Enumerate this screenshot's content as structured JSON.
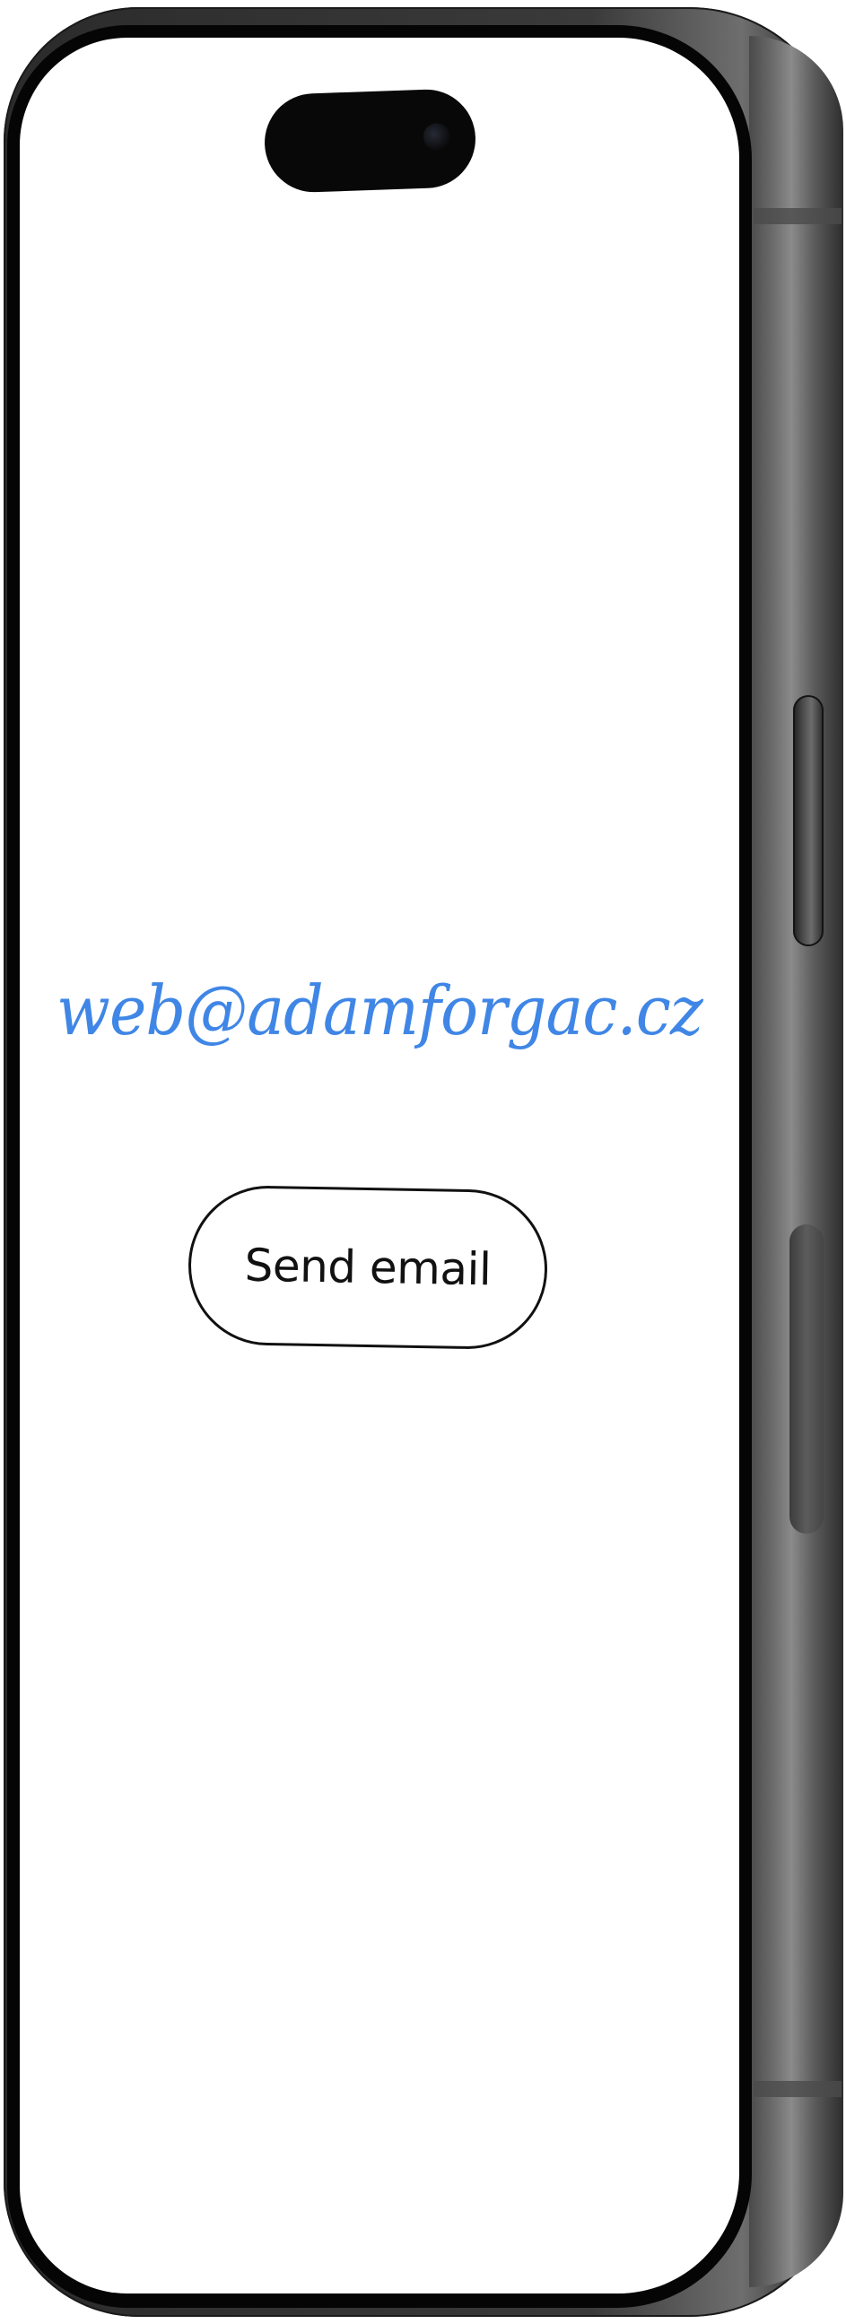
{
  "contact": {
    "email": "web@adamforgac.cz",
    "button_label": "Send email"
  },
  "colors": {
    "email_link": "#3f86e6",
    "button_border": "#111111",
    "screen_background": "#ffffff",
    "phone_frame": "#2b2b2b"
  }
}
